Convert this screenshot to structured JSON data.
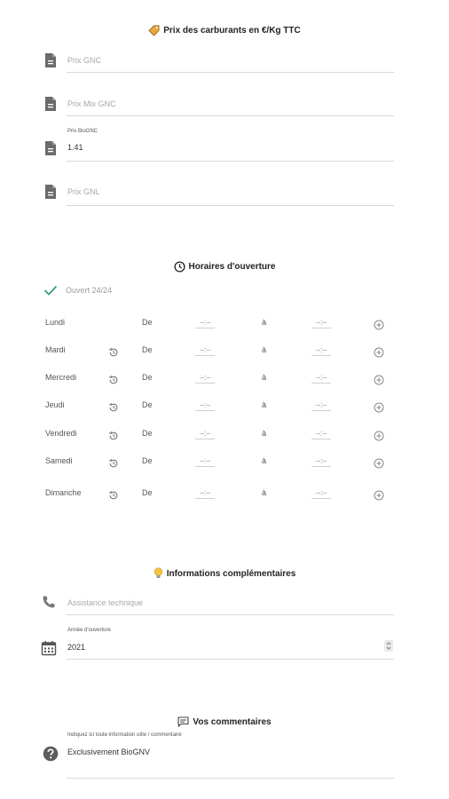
{
  "fuel": {
    "title": "Prix des carburants en €/Kg TTC",
    "icon": "price-tag-icon",
    "fields": [
      {
        "placeholder": "Prix GNC",
        "label": "",
        "value": ""
      },
      {
        "placeholder": "Prix Mix GNC",
        "label": "",
        "value": ""
      },
      {
        "placeholder": "",
        "label": "Prix BioGNC",
        "value": "1.41"
      },
      {
        "placeholder": "Prix GNL",
        "label": "",
        "value": ""
      }
    ]
  },
  "hours": {
    "title": "Horaires d'ouverture",
    "icon": "clock-icon",
    "open_24": "Ouvert 24/24",
    "de": "De",
    "a": "à",
    "time_placeholder": "--:--",
    "days": [
      "Lundi",
      "Mardi",
      "Mercredi",
      "Jeudi",
      "Vendredi",
      "Samedi",
      "Dimanche"
    ]
  },
  "info": {
    "title": "Informations complémentaires",
    "icon": "lightbulb-icon",
    "assistance_placeholder": "Assistance technique",
    "year_label": "Année d'ouverture",
    "year_value": "2021"
  },
  "comments": {
    "title": "Vos commentaires",
    "icon": "comment-icon",
    "label": "Indiquez ici toute information utile / commentaire",
    "value": "Exclusivement BioGNV"
  },
  "colors": {
    "check": "#2e9e7e",
    "lightbulb": "#f5c542",
    "tag": "#e8a83a"
  }
}
